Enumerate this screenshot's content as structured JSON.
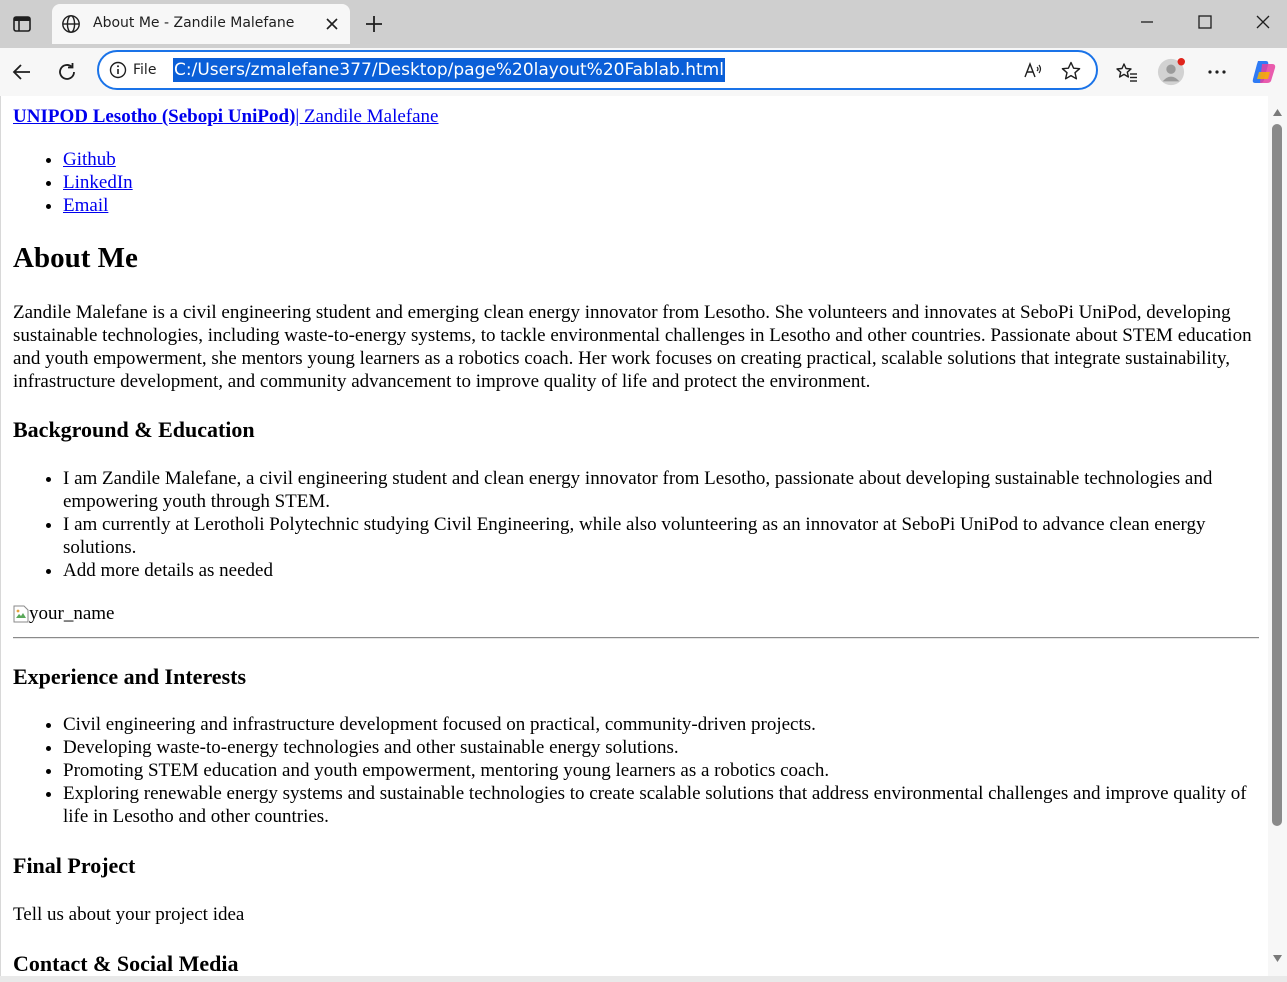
{
  "browser": {
    "tab_title": "About Me - Zandile Malefane",
    "address_scheme_label": "File",
    "url": "C:/Users/zmalefane377/Desktop/page%20layout%20Fablab.html",
    "accent_color": "#1a73e8"
  },
  "page": {
    "header": {
      "brand": "UNIPOD Lesotho (Sebopi UniPod)",
      "name": "| Zandile Malefane"
    },
    "links": [
      "Github",
      "LinkedIn",
      "Email"
    ],
    "about_title": "About Me",
    "about_text": "Zandile Malefane is a civil engineering student and emerging clean energy innovator from Lesotho. She volunteers and innovates at SeboPi UniPod, developing sustainable technologies, including waste-to-energy systems, to tackle environmental challenges in Lesotho and other countries. Passionate about STEM education and youth empowerment, she mentors young learners as a robotics coach. Her work focuses on creating practical, scalable solutions that integrate sustainability, infrastructure development, and community advancement to improve quality of life and protect the environment.",
    "background": {
      "title": "Background & Education",
      "items": [
        "I am Zandile Malefane, a civil engineering student and clean energy innovator from Lesotho, passionate about developing sustainable technologies and empowering youth through STEM.",
        "I am currently at Lerotholi Polytechnic studying Civil Engineering, while also volunteering as an innovator at SeboPi UniPod to advance clean energy solutions.",
        "Add more details as needed"
      ]
    },
    "image_alt": "your_name",
    "experience": {
      "title": "Experience and Interests",
      "items": [
        "Civil engineering and infrastructure development focused on practical, community-driven projects.",
        "Developing waste-to-energy technologies and other sustainable energy solutions.",
        "Promoting STEM education and youth empowerment, mentoring young learners as a robotics coach.",
        "Exploring renewable energy systems and sustainable technologies to create scalable solutions that address environmental challenges and improve quality of life in Lesotho and other countries."
      ]
    },
    "final_project": {
      "title": "Final Project",
      "text": "Tell us about your project idea"
    },
    "contact": {
      "title": "Contact & Social Media"
    }
  }
}
